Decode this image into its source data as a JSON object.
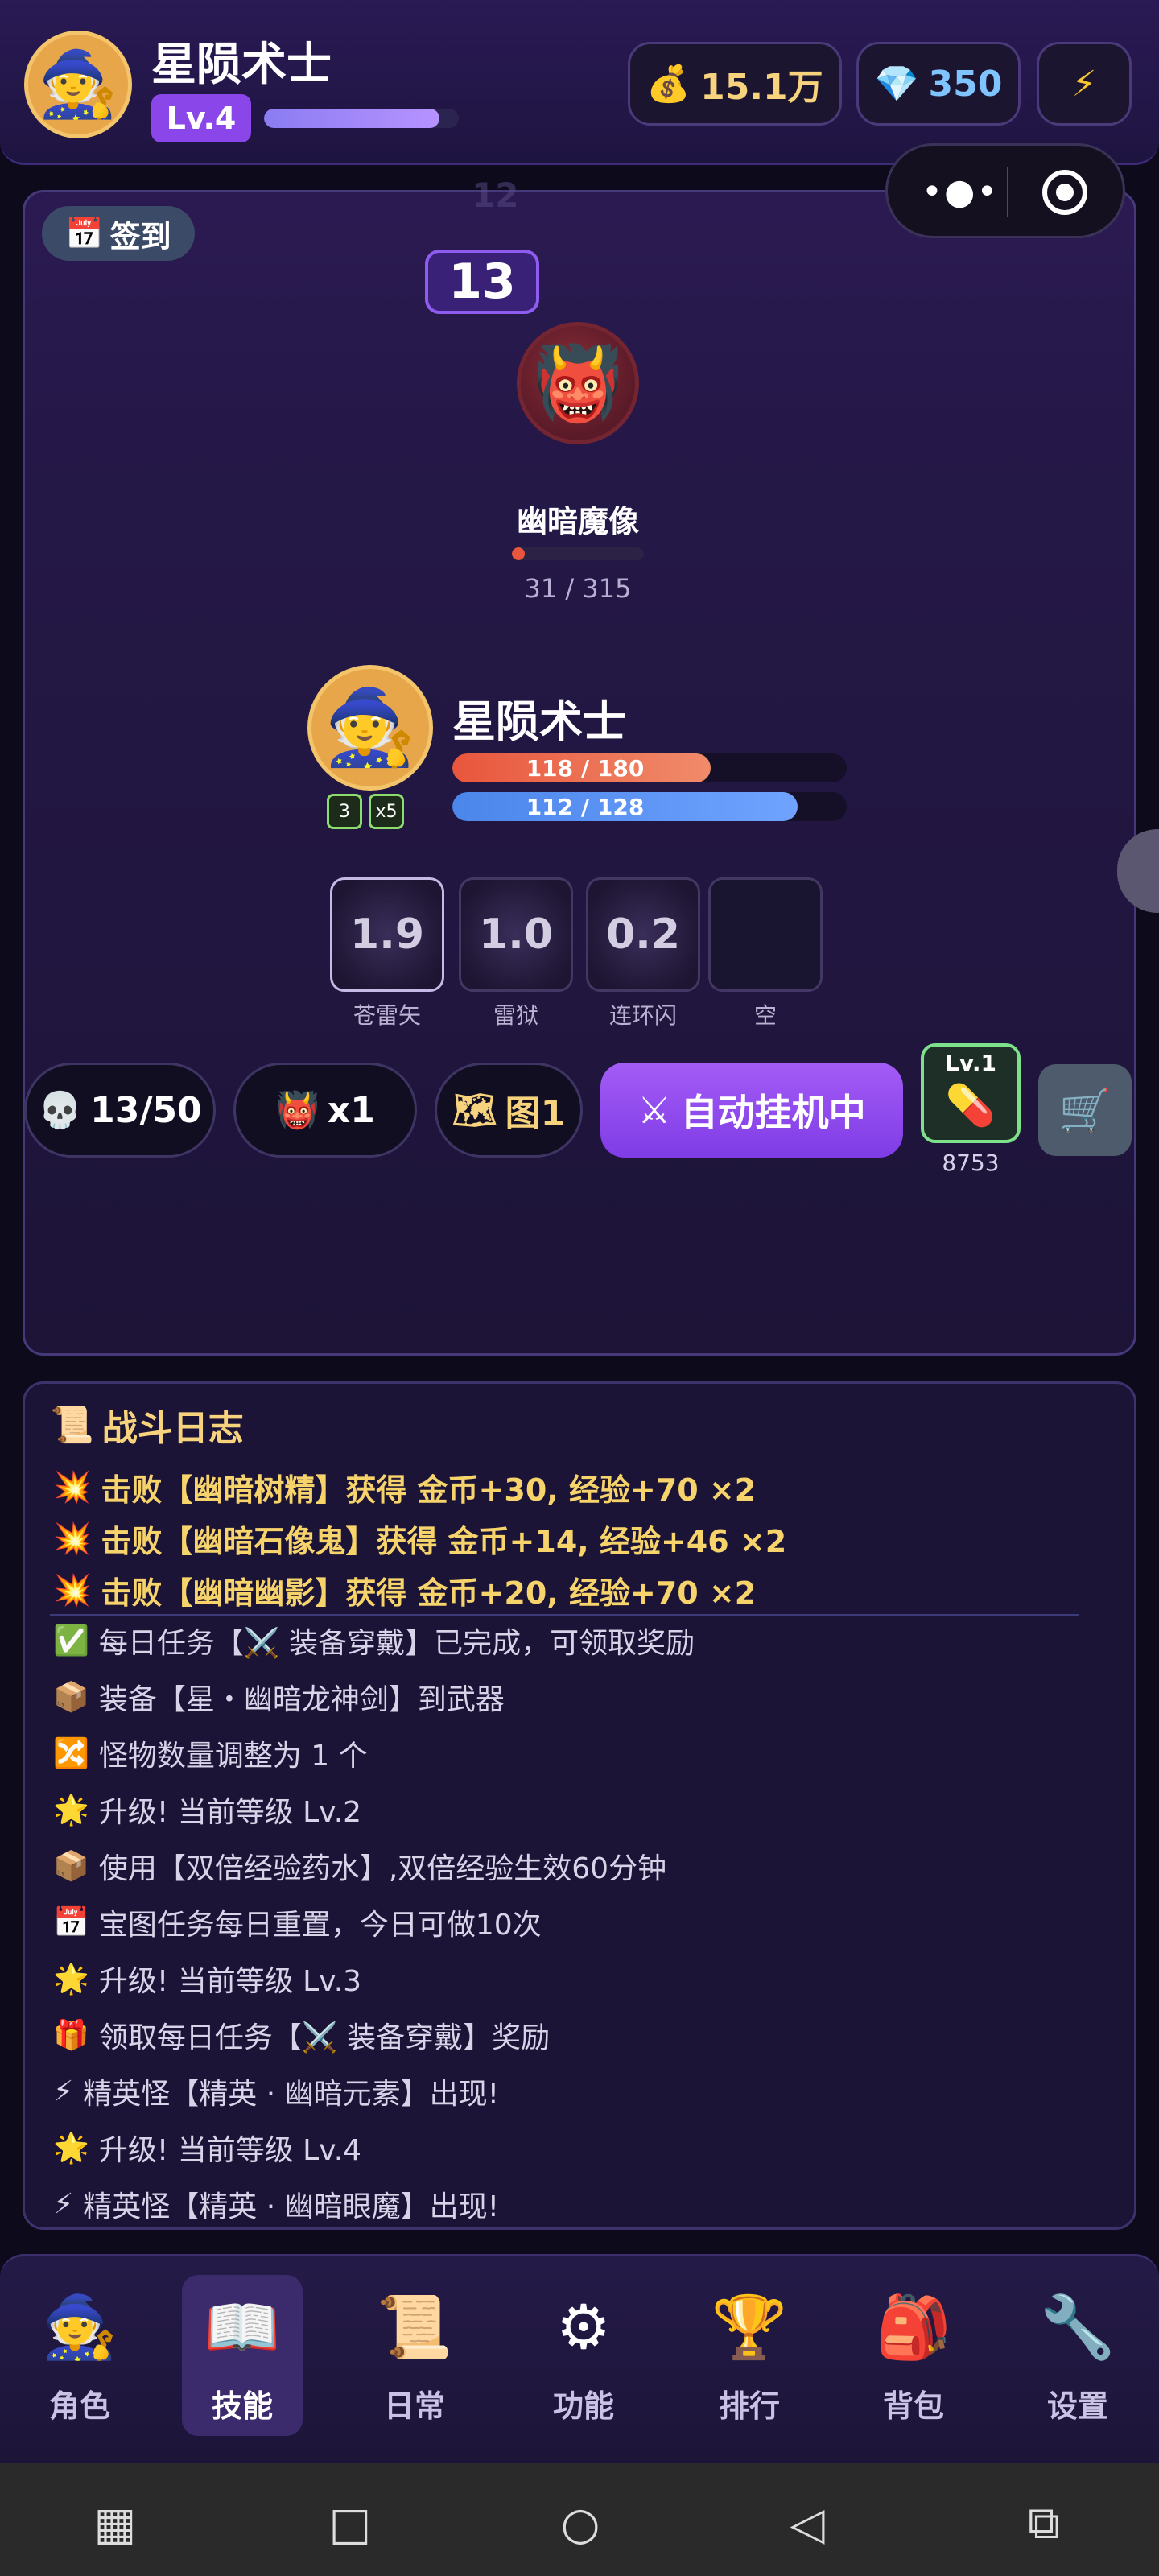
{
  "header": {
    "player_name": "星陨术士",
    "level": "Lv.4",
    "xp_progress": 0.9,
    "gold": "15.1万",
    "gems": "350",
    "avatar_icon": "wizard-icon",
    "gold_icon": "money-bag-icon",
    "gem_icon": "diamond-icon",
    "energy_icon": "lightning-icon"
  },
  "battle": {
    "sign_in_label": "签到",
    "ghost_stage": "12",
    "stage": "13",
    "monster": {
      "name": "幽暗魔像",
      "hp_text": "31 / 315",
      "hp_fraction": 0.098,
      "icon": "oni-mask-icon"
    },
    "hero": {
      "name": "星陨术士",
      "hp_text": "118 / 180",
      "hp_fraction": 0.656,
      "mp_text": "112 / 128",
      "mp_fraction": 0.875,
      "buff1": "3",
      "buff2": "x5"
    },
    "skills": [
      {
        "label": "苍雷矢",
        "cooldown": "1.9"
      },
      {
        "label": "雷狱",
        "cooldown": "1.0"
      },
      {
        "label": "连环闪",
        "cooldown": "0.2"
      },
      {
        "label": "空",
        "cooldown": ""
      }
    ],
    "kills": "13/50",
    "monster_count": "x1",
    "map": "图1",
    "auto_label": "自动挂机中",
    "potion_level": "Lv.1",
    "potion_count": "8753"
  },
  "log": {
    "title": "战斗日志",
    "highlight_lines": [
      "击败【幽暗树精】获得 金币+30, 经验+70 ×2",
      "击败【幽暗石像鬼】获得 金币+14, 经验+46 ×2",
      "击败【幽暗幽影】获得 金币+20, 经验+70 ×2"
    ],
    "lines": [
      {
        "icon": "✅",
        "text": "每日任务【⚔️ 装备穿戴】已完成，可领取奖励"
      },
      {
        "icon": "📦",
        "text": "装备【星・幽暗龙神剑】到武器"
      },
      {
        "icon": "🔀",
        "text": "怪物数量调整为 1 个"
      },
      {
        "icon": "🌟",
        "text": "升级! 当前等级 Lv.2"
      },
      {
        "icon": "📦",
        "text": "使用【双倍经验药水】,双倍经验生效60分钟"
      },
      {
        "icon": "📅",
        "text": "宝图任务每日重置，今日可做10次"
      },
      {
        "icon": "🌟",
        "text": "升级! 当前等级 Lv.3"
      },
      {
        "icon": "🎁",
        "text": "领取每日任务【⚔️ 装备穿戴】奖励"
      },
      {
        "icon": "⚡",
        "text": "精英怪【精英 · 幽暗元素】出现!"
      },
      {
        "icon": "🌟",
        "text": "升级! 当前等级 Lv.4"
      },
      {
        "icon": "⚡",
        "text": "精英怪【精英 · 幽暗眼魔】出现!"
      }
    ]
  },
  "nav": [
    {
      "label": "角色",
      "icon": "wizard-icon"
    },
    {
      "label": "技能",
      "icon": "book-icon"
    },
    {
      "label": "日常",
      "icon": "scroll-icon"
    },
    {
      "label": "功能",
      "icon": "gear-icon"
    },
    {
      "label": "排行",
      "icon": "trophy-icon"
    },
    {
      "label": "背包",
      "icon": "backpack-icon"
    },
    {
      "label": "设置",
      "icon": "wrench-icon"
    }
  ]
}
